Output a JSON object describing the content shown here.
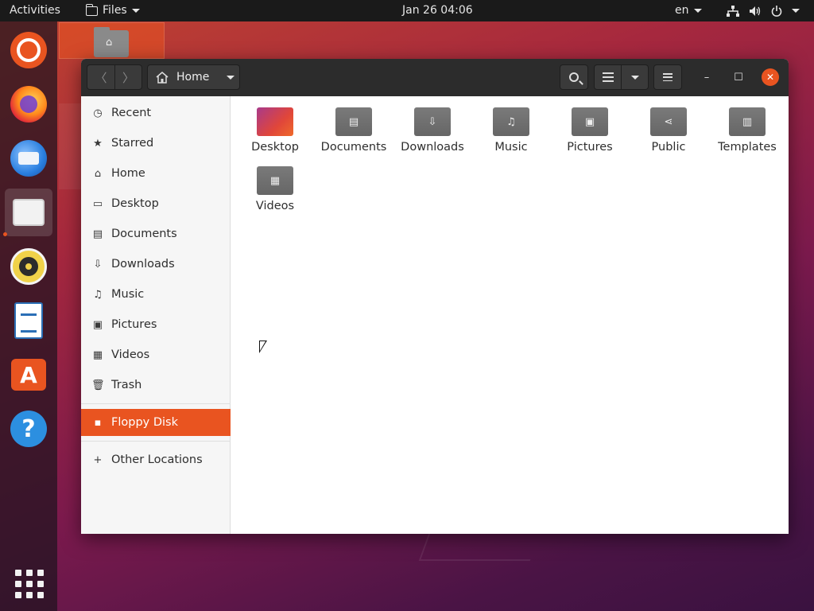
{
  "topbar": {
    "activities": "Activities",
    "app_menu": "Files",
    "clock": "Jan 26  04:06",
    "language": "en"
  },
  "dock": {
    "items": [
      {
        "name": "ubuntu-icon"
      },
      {
        "name": "firefox-icon"
      },
      {
        "name": "thunderbird-icon"
      },
      {
        "name": "files-icon",
        "active": true
      },
      {
        "name": "rhythmbox-icon"
      },
      {
        "name": "libreoffice-writer-icon"
      },
      {
        "name": "software-store-icon",
        "glyph": "A"
      },
      {
        "name": "help-icon",
        "glyph": "?"
      },
      {
        "name": "show-applications-icon"
      }
    ]
  },
  "window": {
    "path_label": "Home",
    "sidebar": {
      "items": [
        {
          "label": "Recent",
          "icon": "clock-icon"
        },
        {
          "label": "Starred",
          "icon": "star-icon"
        },
        {
          "label": "Home",
          "icon": "home-icon"
        },
        {
          "label": "Desktop",
          "icon": "desktop-icon"
        },
        {
          "label": "Documents",
          "icon": "document-icon"
        },
        {
          "label": "Downloads",
          "icon": "download-icon"
        },
        {
          "label": "Music",
          "icon": "music-icon"
        },
        {
          "label": "Pictures",
          "icon": "picture-icon"
        },
        {
          "label": "Videos",
          "icon": "video-icon"
        },
        {
          "label": "Trash",
          "icon": "trash-icon"
        }
      ],
      "devices": [
        {
          "label": "Floppy Disk",
          "icon": "floppy-icon",
          "active": true
        }
      ],
      "other": [
        {
          "label": "Other Locations",
          "icon": "plus-icon"
        }
      ]
    },
    "folders": [
      {
        "label": "Desktop",
        "icon": "desktop-folder-icon"
      },
      {
        "label": "Documents",
        "icon": "documents-folder-icon"
      },
      {
        "label": "Downloads",
        "icon": "downloads-folder-icon"
      },
      {
        "label": "Music",
        "icon": "music-folder-icon"
      },
      {
        "label": "Pictures",
        "icon": "pictures-folder-icon"
      },
      {
        "label": "Public",
        "icon": "public-folder-icon"
      },
      {
        "label": "Templates",
        "icon": "templates-folder-icon"
      },
      {
        "label": "Videos",
        "icon": "videos-folder-icon"
      }
    ]
  },
  "colors": {
    "accent": "#e95420",
    "topbar_bg": "#1a1a1a",
    "headerbar_bg": "#2c2c2c"
  }
}
